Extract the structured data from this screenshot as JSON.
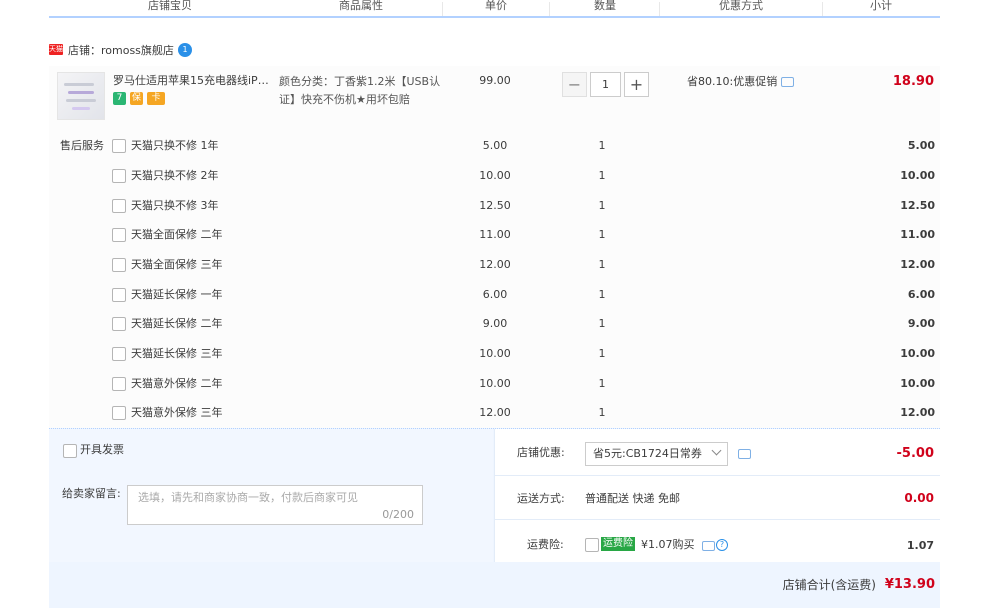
{
  "header": {
    "columns": [
      "店铺宝贝",
      "商品属性",
      "单价",
      "数量",
      "优惠方式",
      "小计"
    ]
  },
  "shop": {
    "tag": "天猫",
    "name": "店铺：romoss旗舰店",
    "chat_badge": "1"
  },
  "item": {
    "title": "罗马仕适用苹果15充电器线iPh…",
    "badges": [
      "7",
      "保",
      "卡"
    ],
    "attr_line1": "颜色分类：丁香紫1.2米【USB认",
    "attr_line2": "证】快充不伤机★用坏包赔",
    "price": "99.00",
    "quantity": "1",
    "minus": "−",
    "plus": "+",
    "promo": "省80.10:优惠促销",
    "subtotal": "18.90"
  },
  "services": {
    "label": "售后服务",
    "rows": [
      {
        "name": "天猫只换不修 1年",
        "price": "5.00",
        "qty": "1",
        "subtotal": "5.00"
      },
      {
        "name": "天猫只换不修 2年",
        "price": "10.00",
        "qty": "1",
        "subtotal": "10.00"
      },
      {
        "name": "天猫只换不修 3年",
        "price": "12.50",
        "qty": "1",
        "subtotal": "12.50"
      },
      {
        "name": "天猫全面保修 二年",
        "price": "11.00",
        "qty": "1",
        "subtotal": "11.00"
      },
      {
        "name": "天猫全面保修 三年",
        "price": "12.00",
        "qty": "1",
        "subtotal": "12.00"
      },
      {
        "name": "天猫延长保修 一年",
        "price": "6.00",
        "qty": "1",
        "subtotal": "6.00"
      },
      {
        "name": "天猫延长保修 二年",
        "price": "9.00",
        "qty": "1",
        "subtotal": "9.00"
      },
      {
        "name": "天猫延长保修 三年",
        "price": "10.00",
        "qty": "1",
        "subtotal": "10.00"
      },
      {
        "name": "天猫意外保修 二年",
        "price": "10.00",
        "qty": "1",
        "subtotal": "10.00"
      },
      {
        "name": "天猫意外保修 三年",
        "price": "12.00",
        "qty": "1",
        "subtotal": "12.00"
      }
    ]
  },
  "invoice": {
    "label": "开具发票"
  },
  "message": {
    "label": "给卖家留言:",
    "placeholder": "选填，请先和商家协商一致，付款后商家可见",
    "counter": "0/200"
  },
  "coupon": {
    "label": "店铺优惠:",
    "selected": "省5元:CB1724日常券",
    "amount": "-5.00"
  },
  "shipping": {
    "label": "运送方式:",
    "value": "普通配送 快递 免邮",
    "amount": "0.00"
  },
  "insurance": {
    "label": "运费险:",
    "tag": "运费险",
    "text": "¥1.07购买",
    "help": "?",
    "amount": "1.07"
  },
  "total": {
    "label": "店铺合计(含运费)",
    "value": "¥13.90"
  },
  "colors": {
    "accent_red": "#d0021b",
    "header_line": "#b2d1ff",
    "insurance_green": "#28a745"
  }
}
